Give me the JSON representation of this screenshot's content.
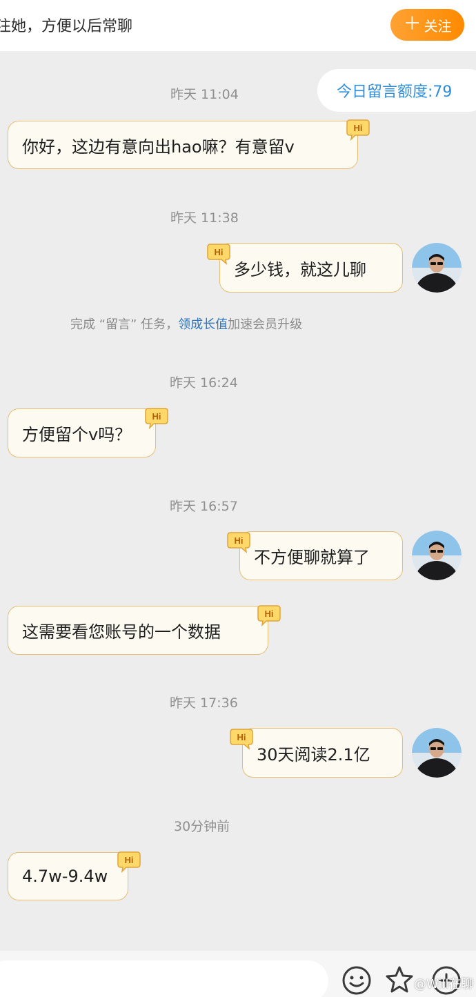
{
  "header": {
    "hint_text": "注她，方便以后常聊",
    "follow_plus": "＋",
    "follow_label": "关注"
  },
  "quota_text": "今日留言额度:79",
  "messages": [
    {
      "time": "昨天 11:04",
      "side": "left",
      "text": "你好，这边有意向出hao嘛？有意留v"
    },
    {
      "time": "昨天 11:38",
      "side": "right",
      "text": "多少钱，就这儿聊"
    },
    {
      "time": "昨天 16:24",
      "side": "left",
      "text": "方便留个v吗？"
    },
    {
      "time": "昨天 16:57",
      "side": "right",
      "text": "不方便聊就算了"
    },
    {
      "time": "",
      "side": "left",
      "text": "这需要看您账号的一个数据"
    },
    {
      "time": "昨天 17:36",
      "side": "right",
      "text": "30天阅读2.1亿"
    },
    {
      "time": "30分钟前",
      "side": "left",
      "text": "4.7w-9.4w"
    }
  ],
  "notice": {
    "prefix": "完成 “留言” 任务，",
    "link": "领成长值",
    "suffix": "加速会员升级"
  },
  "badge_text": "Hi",
  "watermark": "@Will在聊",
  "colors": {
    "accent_orange": "#ff8a00",
    "link_blue": "#2e76c2",
    "quota_blue": "#2e8ed8",
    "bubble_bg": "#fdfaf1",
    "bubble_border": "#e7bd73"
  },
  "icons": [
    "emoji-icon",
    "sticker-icon",
    "add-icon"
  ]
}
